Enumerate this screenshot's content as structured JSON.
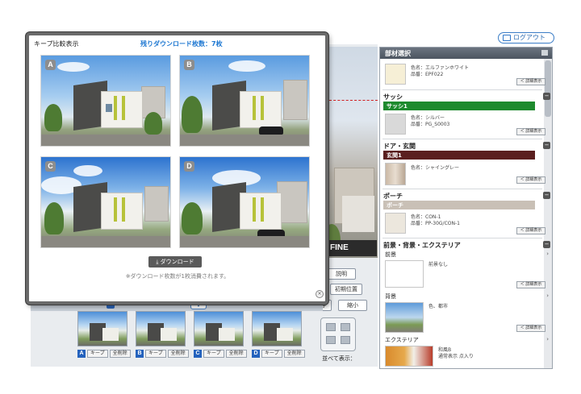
{
  "header": {
    "logout_label": "ログアウト"
  },
  "modal": {
    "title": "キープ比較表示",
    "remaining_downloads": "残りダウンロード枚数：7枚",
    "images": [
      {
        "label": "A"
      },
      {
        "label": "B"
      },
      {
        "label": "C"
      },
      {
        "label": "D"
      }
    ],
    "download_label": "ダウンロード",
    "download_note": "※ダウンロード枚数が1枚消費されます。"
  },
  "background": {
    "logo_text": "FINE",
    "buttons": {
      "explain": "説明",
      "initial_position": "初期位置",
      "save": "保存",
      "shrink": "縮小"
    },
    "thumbs": [
      {
        "label": "A",
        "keep": "キープ",
        "delete": "全削除"
      },
      {
        "label": "B",
        "keep": "キープ",
        "delete": "全削除"
      },
      {
        "label": "C",
        "keep": "キープ",
        "delete": "全削除"
      },
      {
        "label": "D",
        "keep": "キープ",
        "delete": "全削除"
      }
    ],
    "show_all_label": "並べて表示："
  },
  "panel": {
    "title": "部材選択",
    "top_item": {
      "color": "色名：エルファンホワイト",
      "code": "品番：EPF022",
      "detail": "＜ 詳細表示"
    },
    "sections": [
      {
        "title": "サッシ",
        "bar": "サッシ1",
        "bar_color": "#1e8a2e",
        "color": "色名：シルバー",
        "code": "品番：PG_S0003",
        "detail": "＜ 詳細表示"
      },
      {
        "title": "ドア・玄関",
        "bar": "玄関1",
        "bar_color": "#5a1f1f",
        "color": "色名：シャイングレー",
        "code": "",
        "detail": "＜ 詳細表示"
      },
      {
        "title": "ポーチ",
        "bar": "ポーチ",
        "bar_color": "#c9c0b6",
        "color": "色名：CON-1",
        "code": "品番：PP-30G/CON-1",
        "detail": "＜ 詳細表示"
      },
      {
        "title": "前景・背景・エクステリア"
      }
    ],
    "foreground": {
      "title": "前景",
      "text": "前景なし",
      "detail": "＜ 詳細表示"
    },
    "background": {
      "title": "背景",
      "text": "色、都市",
      "detail": "＜ 詳細表示"
    },
    "exterior": {
      "title": "エクステリア",
      "line1": "和風B",
      "line2": "通常表示 点入り"
    }
  }
}
